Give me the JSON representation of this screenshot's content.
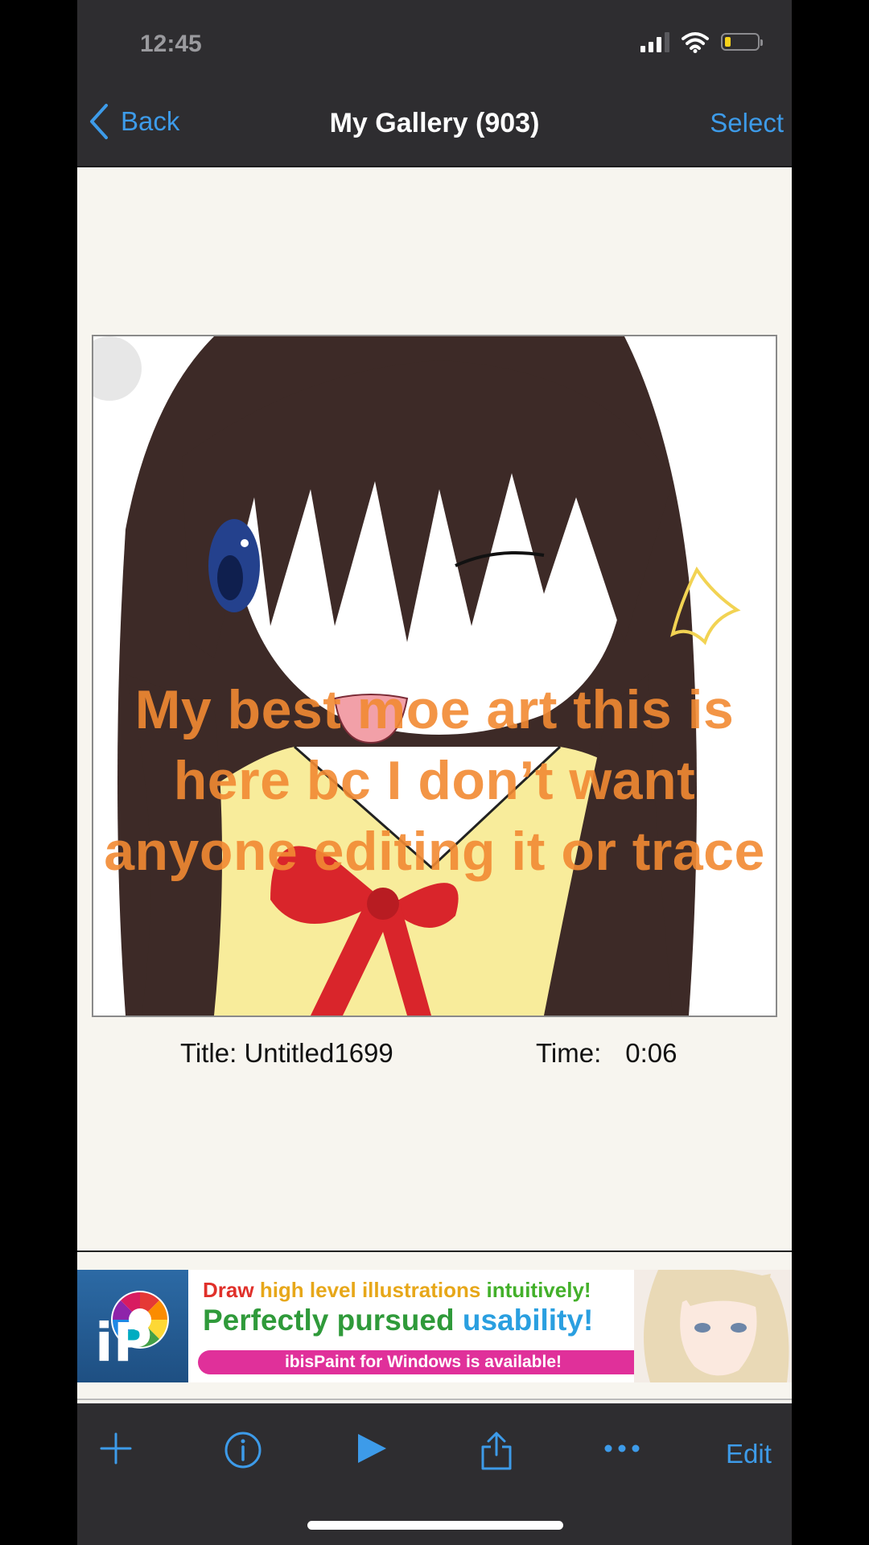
{
  "status_bar": {
    "time": "12:45"
  },
  "nav": {
    "back_label": "Back",
    "title": "My Gallery (903)",
    "select_label": "Select"
  },
  "artwork": {
    "overlay_text": "My best moe art  this is\nhere bc I don’t want\nanyone editing it or trace"
  },
  "info": {
    "title_text": "Title: Untitled1699",
    "time_label": "Time:",
    "time_value": "0:06"
  },
  "ad": {
    "line1": [
      {
        "text": "Draw ",
        "color": "#e0302a"
      },
      {
        "text": "high level illustrations ",
        "color": "#e7a719"
      },
      {
        "text": "intuitively!",
        "color": "#43b02a"
      }
    ],
    "line2": [
      {
        "text": "Perfectly pursued ",
        "color": "#2f9a3a"
      },
      {
        "text": "usability!",
        "color": "#2a9fe0"
      }
    ],
    "pill_text": "ibisPaint for Windows is available!",
    "logo_text": "iP"
  },
  "toolbar": {
    "items": [
      "add-icon",
      "info-icon",
      "play-icon",
      "share-icon",
      "more-icon"
    ],
    "edit_label": "Edit"
  },
  "colors": {
    "accent": "#3d9be9",
    "bar": "#2e2d30",
    "background": "#f7f5ef",
    "overlay": "#f28a33"
  }
}
